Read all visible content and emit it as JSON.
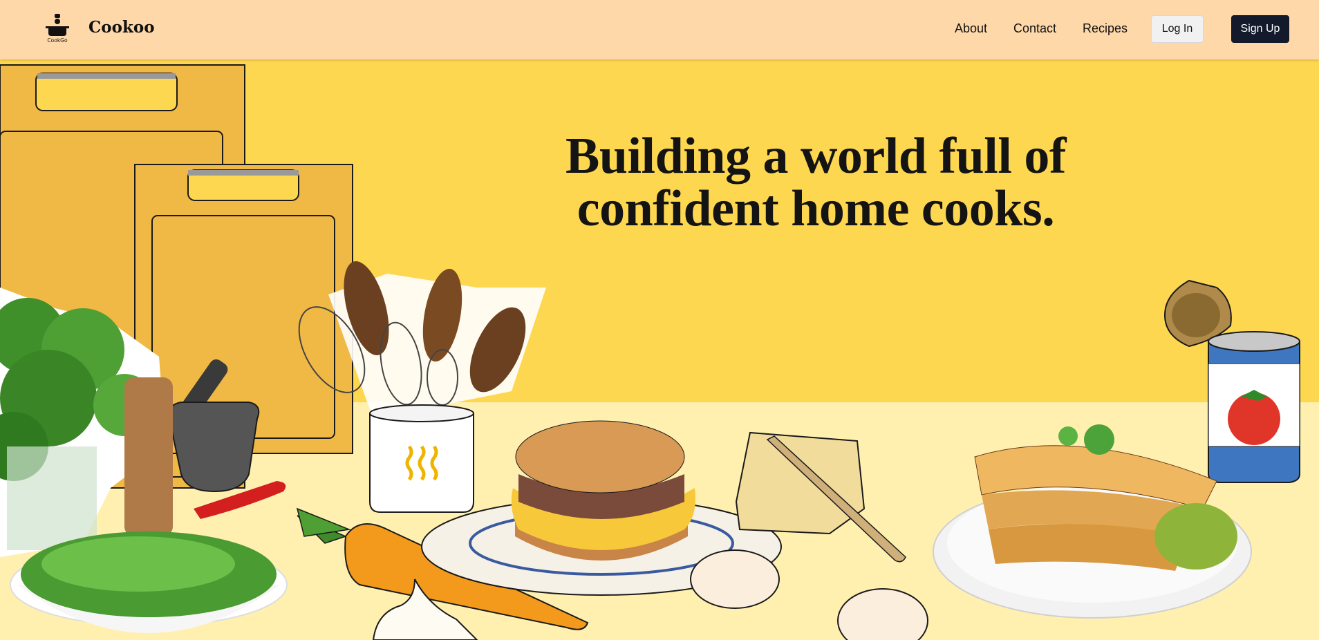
{
  "header": {
    "brand": "Cookoo",
    "logo_text": "CookGo",
    "logo_icon": "chef-cooking-icon",
    "nav": [
      {
        "label": "About"
      },
      {
        "label": "Contact"
      },
      {
        "label": "Recipes"
      }
    ],
    "login_label": "Log In",
    "signup_label": "Sign Up"
  },
  "hero": {
    "headline_line1": "Building a world full of",
    "headline_line2": "confident home cooks."
  },
  "colors": {
    "header_bg": "#fed8a9",
    "wall": "#fed751",
    "table": "#fff0b0",
    "signup_bg": "#121a2b"
  }
}
